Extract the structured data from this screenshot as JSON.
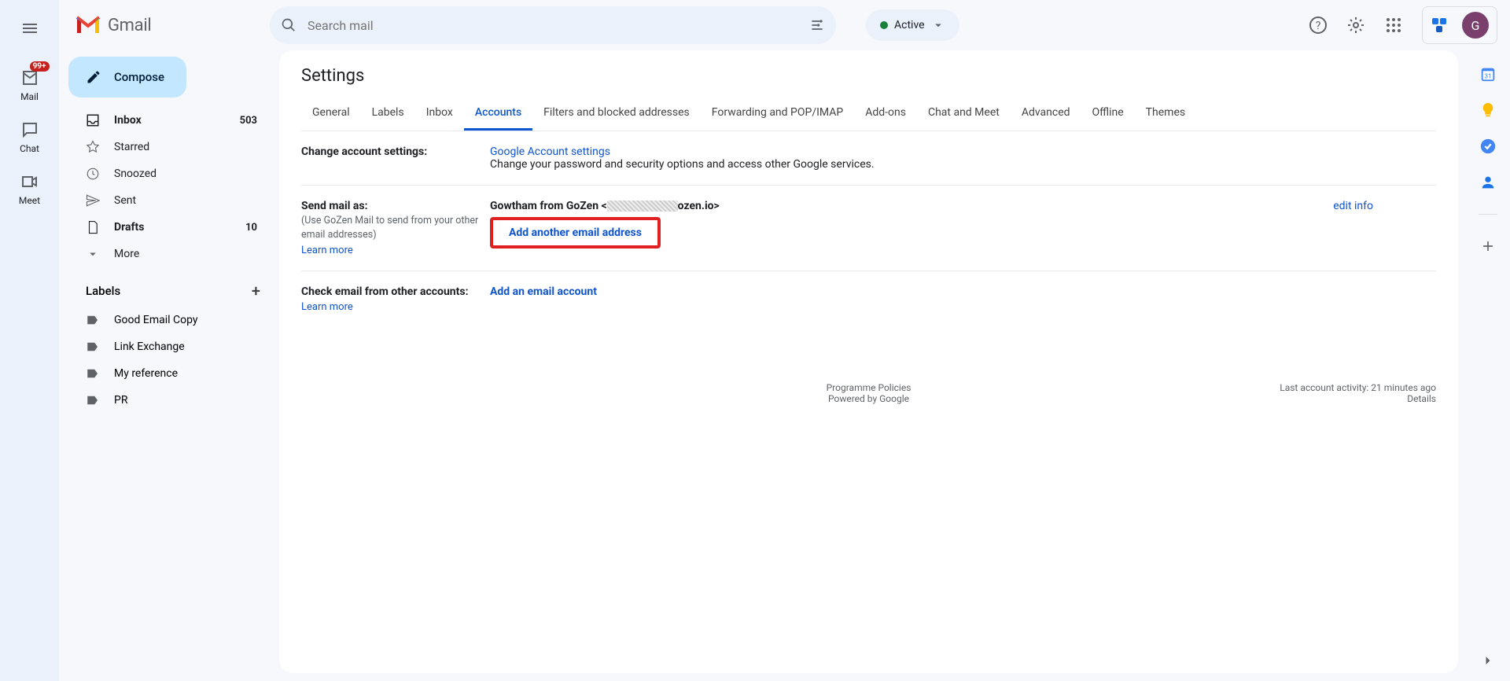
{
  "rail": {
    "mail": "Mail",
    "chat": "Chat",
    "meet": "Meet",
    "badge": "99+"
  },
  "header": {
    "logo_text": "Gmail",
    "search_placeholder": "Search mail",
    "status": "Active",
    "avatar_initial": "G"
  },
  "sidebar": {
    "compose": "Compose",
    "items": [
      {
        "label": "Inbox",
        "count": "503",
        "bold": true
      },
      {
        "label": "Starred"
      },
      {
        "label": "Snoozed"
      },
      {
        "label": "Sent"
      },
      {
        "label": "Drafts",
        "count": "10",
        "bold": true
      },
      {
        "label": "More"
      }
    ],
    "labels_header": "Labels",
    "labels": [
      "Good Email Copy",
      "Link Exchange",
      "My reference",
      "PR"
    ]
  },
  "content": {
    "title": "Settings",
    "tabs": [
      "General",
      "Labels",
      "Inbox",
      "Accounts",
      "Filters and blocked addresses",
      "Forwarding and POP/IMAP",
      "Add-ons",
      "Chat and Meet",
      "Advanced",
      "Offline",
      "Themes"
    ],
    "active_tab_index": 3,
    "rows": {
      "change_account": {
        "label": "Change account settings:",
        "link": "Google Account settings",
        "desc": "Change your password and security options and access other Google services."
      },
      "send_mail": {
        "label": "Send mail as:",
        "sub": "(Use GoZen Mail to send from your other email addresses)",
        "learn": "Learn more",
        "identity_name": "Gowtham from GoZen <",
        "identity_domain": "ozen.io>",
        "edit": "edit info",
        "add_link": "Add another email address"
      },
      "check_mail": {
        "label": "Check email from other accounts:",
        "learn": "Learn more",
        "add_link": "Add an email account"
      }
    },
    "footer": {
      "policies": "Programme Policies",
      "powered": "Powered by ",
      "google": "Google",
      "activity": "Last account activity: 21 minutes ago",
      "details": "Details"
    }
  }
}
